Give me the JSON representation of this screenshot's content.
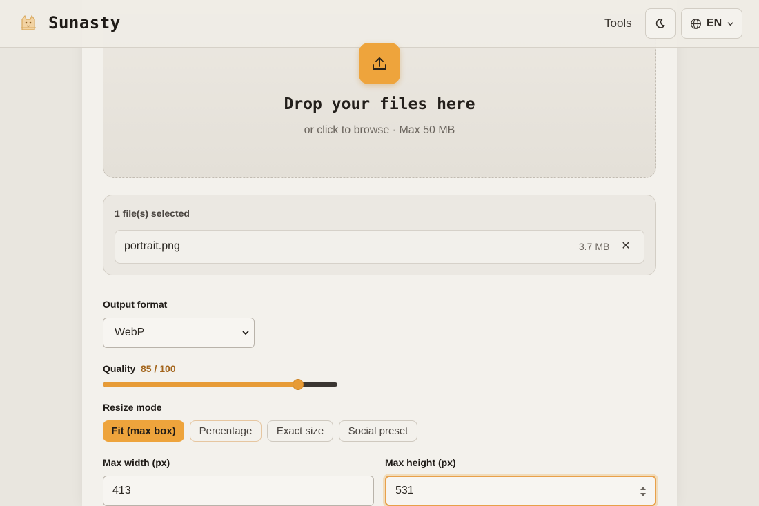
{
  "header": {
    "brand": "Sunasty",
    "tools_link": "Tools",
    "language": "EN",
    "icons": {
      "logo": "cat-logo-icon",
      "theme": "moon-icon",
      "language": "globe-icon",
      "chevron": "chevron-down-icon"
    }
  },
  "dropzone": {
    "title": "Drop your files here",
    "subtitle": "or click to browse · Max 50 MB",
    "icon": "upload-icon"
  },
  "files": {
    "count_label": "1 file(s) selected",
    "items": [
      {
        "name": "portrait.png",
        "size": "3.7 MB",
        "remove": "✕"
      }
    ]
  },
  "output_format": {
    "label": "Output format",
    "selected": "WebP"
  },
  "quality": {
    "label": "Quality",
    "value_text": "85 / 100",
    "value": 85,
    "max": 100
  },
  "resize_mode": {
    "label": "Resize mode",
    "options": [
      "Fit (max box)",
      "Percentage",
      "Exact size",
      "Social preset"
    ],
    "selected": "Fit (max box)"
  },
  "dimensions": {
    "width_label": "Max width (px)",
    "width_value": "413",
    "height_label": "Max height (px)",
    "height_value": "531"
  },
  "colors": {
    "accent": "#eea43c",
    "accent_text": "#a3651c",
    "background": "#e9e6df",
    "panel": "#f3f1ec"
  }
}
